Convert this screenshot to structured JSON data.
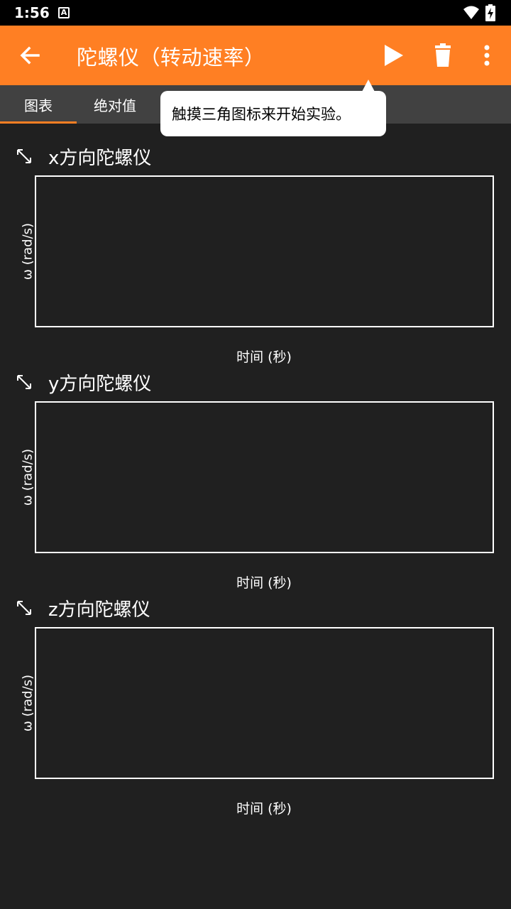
{
  "status_bar": {
    "time": "1:56",
    "notification_icon": "A"
  },
  "app_bar": {
    "title": "陀螺仪（转动速率）"
  },
  "tabs": [
    {
      "label": "图表"
    },
    {
      "label": "绝对值"
    }
  ],
  "tooltip": {
    "text": "触摸三角图标来开始实验。"
  },
  "graphs": [
    {
      "title": "x方向陀螺仪",
      "ylabel": "ω (rad/s)",
      "xlabel": "时间 (秒)"
    },
    {
      "title": "y方向陀螺仪",
      "ylabel": "ω (rad/s)",
      "xlabel": "时间 (秒)"
    },
    {
      "title": "z方向陀螺仪",
      "ylabel": "ω (rad/s)",
      "xlabel": "时间 (秒)"
    }
  ],
  "colors": {
    "accent": "#ff7f23",
    "background": "#202020",
    "tab_bar": "#414141"
  }
}
